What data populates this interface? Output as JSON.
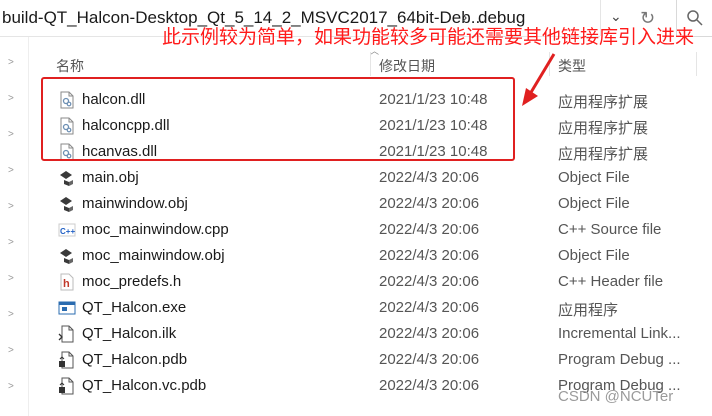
{
  "address_bar": {
    "path_text": "build-QT_Halcon-Desktop_Qt_5_14_2_MSVC2017_64bit-Deb...",
    "separator": "›",
    "current_folder": "debug",
    "dropdown_glyph": "⌄",
    "refresh_glyph": "↻"
  },
  "columns": {
    "name": "名称",
    "date": "修改日期",
    "type": "类型"
  },
  "files": [
    {
      "name": "halcon.dll",
      "date": "2021/1/23 10:48",
      "type": "应用程序扩展",
      "icon": "dll-file-icon"
    },
    {
      "name": "halconcpp.dll",
      "date": "2021/1/23 10:48",
      "type": "应用程序扩展",
      "icon": "dll-file-icon"
    },
    {
      "name": "hcanvas.dll",
      "date": "2021/1/23 10:48",
      "type": "应用程序扩展",
      "icon": "dll-file-icon"
    },
    {
      "name": "main.obj",
      "date": "2022/4/3 20:06",
      "type": "Object File",
      "icon": "obj-file-icon"
    },
    {
      "name": "mainwindow.obj",
      "date": "2022/4/3 20:06",
      "type": "Object File",
      "icon": "obj-file-icon"
    },
    {
      "name": "moc_mainwindow.cpp",
      "date": "2022/4/3 20:06",
      "type": "C++ Source file",
      "icon": "cpp-file-icon"
    },
    {
      "name": "moc_mainwindow.obj",
      "date": "2022/4/3 20:06",
      "type": "Object File",
      "icon": "obj-file-icon"
    },
    {
      "name": "moc_predefs.h",
      "date": "2022/4/3 20:06",
      "type": "C++ Header file",
      "icon": "header-file-icon"
    },
    {
      "name": "QT_Halcon.exe",
      "date": "2022/4/3 20:06",
      "type": "应用程序",
      "icon": "exe-file-icon"
    },
    {
      "name": "QT_Halcon.ilk",
      "date": "2022/4/3 20:06",
      "type": "Incremental Link...",
      "icon": "ilk-file-icon"
    },
    {
      "name": "QT_Halcon.pdb",
      "date": "2022/4/3 20:06",
      "type": "Program Debug ...",
      "icon": "pdb-file-icon"
    },
    {
      "name": "QT_Halcon.vc.pdb",
      "date": "2022/4/3 20:06",
      "type": "Program Debug ...",
      "icon": "pdb-file-icon"
    }
  ],
  "annotation": {
    "text": "此示例较为简单，如果功能较多可能还需要其他链接库引入进来",
    "color": "#ff1a1a"
  },
  "watermark": "CSDN @NCUTer"
}
